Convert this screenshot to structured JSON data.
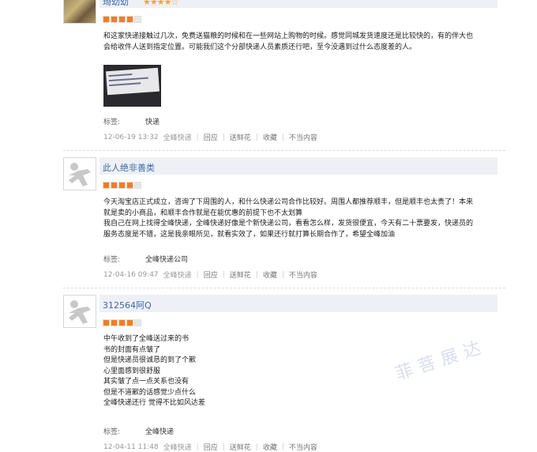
{
  "reviews": [
    {
      "username": "琦幼幼",
      "rating": 4,
      "body_lines": [
        "和这家快递接触过几次，免费送猫粮的时候和在一些网站上购物的时候。感觉同城发货速度还是比较快的，有的伴大也",
        "会给收件人送到指定位置。可能我们这个分部快递人员素质还行吧，至今没遇到过什么态度差的人。"
      ],
      "tags_label": "标签:",
      "tag_value": "快递",
      "date": "12-06-19 13:32",
      "company": "全峰快递",
      "actions": [
        "回应",
        "送鲜花",
        "收藏",
        "不当内容"
      ]
    },
    {
      "username": "此人绝非善类",
      "rating": 4,
      "body_lines": [
        "今天淘宝店正式成立，咨询了下周围的人，和什么快递公司合作比较好。周围人都推荐顺丰，但是顺丰也太贵了！本来",
        "就是卖的小商品，和顺丰合作就是在能优惠的前提下也不太划算",
        "我自己在网上找得全峰快递，全峰快递好像是个新快递公司，看看怎么样，发货很便宜，今天有二十票要发，快递员的",
        "服务态度是不错，这是我亲眼所见，就看实效了，如果还行就打算长期合作了，希望全峰加油"
      ],
      "tags_label": "标签:",
      "tag_value": "全峰快递公司",
      "date": "12-04-16 09:47",
      "company": "全峰快递",
      "actions": [
        "回应",
        "送鲜花",
        "收藏",
        "不当内容"
      ]
    },
    {
      "username": "312564阿Q",
      "rating": 4,
      "body_lines": [
        "中午收到了全峰送过来的书",
        "书的封面有点皱了",
        "但是快递员很诚恳的到了个歉",
        "心里面感到很舒服",
        "其实皱了点一点关系也没有",
        "但是不道歉的话感觉少点什么",
        "全峰快递还行 觉得不比如风达差"
      ],
      "tags_label": "标签:",
      "tag_value": "全峰快递",
      "date": "12-04-11 11:48",
      "company": "全峰快递",
      "actions": [
        "回应",
        "送鲜花",
        "收藏",
        "不当内容"
      ]
    }
  ],
  "watermark": "菲菩展达",
  "colors": {
    "star": "#ff7a1a",
    "username": "#3b6aa8",
    "header_bg": "#eef0f5"
  }
}
